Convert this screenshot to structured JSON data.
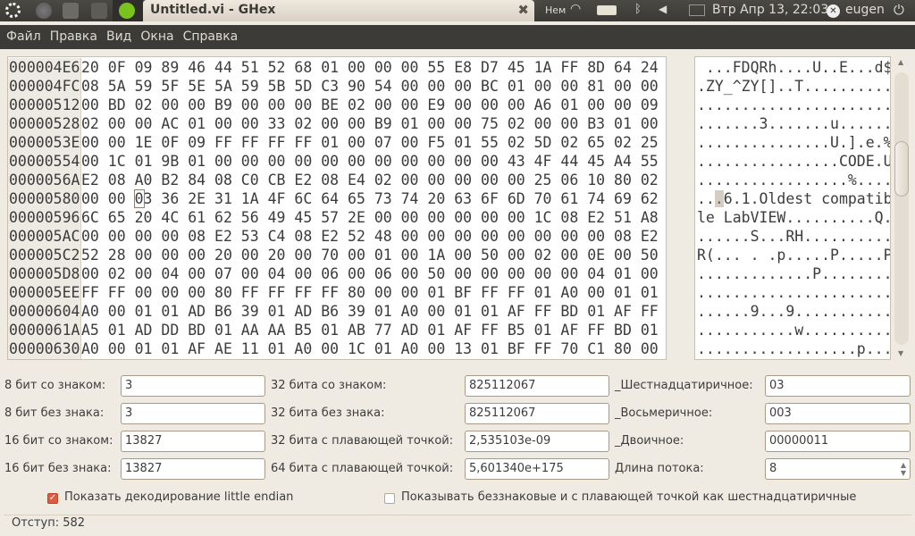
{
  "panel": {
    "window_title": "Untitled.vi - GHex",
    "keyboard_layout": "Нем",
    "datetime": "Втр Апр 13, 22:03",
    "user": "eugen"
  },
  "menu": [
    "Файл",
    "Правка",
    "Вид",
    "Окна",
    "Справка"
  ],
  "hex": {
    "offsets": [
      "000004E6",
      "000004FC",
      "00000512",
      "00000528",
      "0000053E",
      "00000554",
      "0000056A",
      "00000580",
      "00000596",
      "000005AC",
      "000005C2",
      "000005D8",
      "000005EE",
      "00000604",
      "0000061A",
      "00000630"
    ],
    "rows": [
      "20 0F 09 89 46 44 51 52 68 01 00 00 00 55 E8 D7 45 1A FF 8D 64 24",
      "08 5A 59 5F 5E 5A 59 5B 5D C3 90 54 00 00 00 BC 01 00 00 81 00 00",
      "00 BD 02 00 00 B9 00 00 00 BE 02 00 00 E9 00 00 00 A6 01 00 00 09",
      "02 00 00 AC 01 00 00 33 02 00 00 B9 01 00 00 75 02 00 00 B3 01 00",
      "00 00 1E 0F 09 FF FF FF FF 01 00 07 00 F5 01 55 02 5D 02 65 02 25",
      "00 1C 01 9B 01 00 00 00 00 00 00 00 00 00 00 00 43 4F 44 45 A4 55",
      "E2 08 A0 B2 84 08 C0 CB E2 08 E4 02 00 00 00 00 00 25 06 10 80 02",
      "00 00 03 36 2E 31 1A 4F 6C 64 65 73 74 20 63 6F 6D 70 61 74 69 62",
      "6C 65 20 4C 61 62 56 49 45 57 2E 00 00 00 00 00 00 1C 08 E2 51 A8",
      "00 00 00 00 08 E2 53 C4 08 E2 52 48 00 00 00 00 00 00 00 00 08 E2",
      "52 28 00 00 00 20 00 20 00 70 00 01 00 1A 00 50 00 02 00 0E 00 50",
      "00 02 00 04 00 07 00 04 00 06 00 06 00 50 00 00 00 00 00 04 01 00",
      "FF FF 00 00 00 80 FF FF FF FF 80 00 00 01 BF FF FF 01 A0 00 01 01",
      "A0 00 01 01 AD B6 39 01 AD B6 39 01 A0 00 01 01 AF FF BD 01 AF FF",
      "A5 01 AD DD BD 01 AA AA B5 01 AB 77 AD 01 AF FF B5 01 AF FF BD 01",
      "A0 00 01 01 AF AE 11 01 A0 00 1C 01 A0 00 13 01 BF FF 70 C1 80 00"
    ],
    "ascii": [
      " ...FDQRh....U..E...d$",
      ".ZY_^ZY[]..T..........",
      "......................",
      ".......3.......u......",
      "...............U.].e.%",
      "................CODE.U",
      ".................%....",
      "...6.1.Oldest compatib",
      "le LabVIEW..........Q.",
      "......S...RH..........",
      "R(... . .p.....P.....P",
      ".............P........",
      "......................",
      "......9...9...........",
      "...........w..........",
      "..................p..."
    ],
    "cursor_row": 7,
    "cursor_byte": 2
  },
  "fields": [
    {
      "label": "8 бит со знаком:",
      "value": "3"
    },
    {
      "label": "32 бита со знаком:",
      "value": "825112067"
    },
    {
      "label": "_Шестнадцатиричное:",
      "value": "03"
    },
    {
      "label": "8 бит без знака:",
      "value": "3"
    },
    {
      "label": "32 бита без знака:",
      "value": "825112067"
    },
    {
      "label": "_Восьмеричное:",
      "value": "003"
    },
    {
      "label": "16 бит со знаком:",
      "value": "13827"
    },
    {
      "label": "32 бита с плавающей точкой:",
      "value": "2,535103e-09"
    },
    {
      "label": "_Двоичное:",
      "value": "00000011"
    },
    {
      "label": "16 бит без знака:",
      "value": "13827"
    },
    {
      "label": "64 бита с плавающей точкой:",
      "value": "5,601340e+175"
    },
    {
      "label": "Длина потока:",
      "value": "8"
    }
  ],
  "options": {
    "little_endian": {
      "label": "Показать декодирование little endian",
      "checked": true
    },
    "hex_unsigned": {
      "label": "Показывать беззнаковые и с плавающей точкой как шестнадцатиричные",
      "checked": false
    }
  },
  "status": "Отступ: 582"
}
